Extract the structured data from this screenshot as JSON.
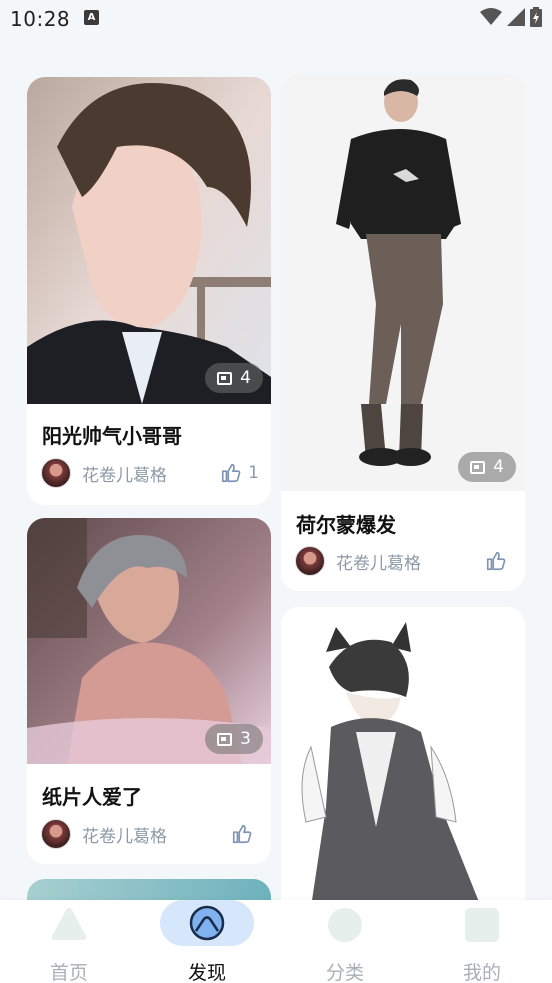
{
  "status_bar": {
    "time": "10:28",
    "notification_letter": "A"
  },
  "cards": [
    {
      "title": "阳光帅气小哥哥",
      "author": "花卷儿葛格",
      "image_count": "4",
      "likes": "1"
    },
    {
      "title": "荷尔蒙爆发",
      "author": "花卷儿葛格",
      "image_count": "4",
      "likes": ""
    },
    {
      "title": "纸片人爱了",
      "author": "花卷儿葛格",
      "image_count": "3",
      "likes": ""
    }
  ],
  "bottom_nav": {
    "items": [
      {
        "label": "首页",
        "icon": "triangle-home-icon",
        "active": false
      },
      {
        "label": "发现",
        "icon": "discover-icon",
        "active": true
      },
      {
        "label": "分类",
        "icon": "circle-category-icon",
        "active": false
      },
      {
        "label": "我的",
        "icon": "square-profile-icon",
        "active": false
      }
    ],
    "active_color": "#111111",
    "inactive_color": "#a9b0b8",
    "active_bubble_color": "#d6e6fb"
  }
}
